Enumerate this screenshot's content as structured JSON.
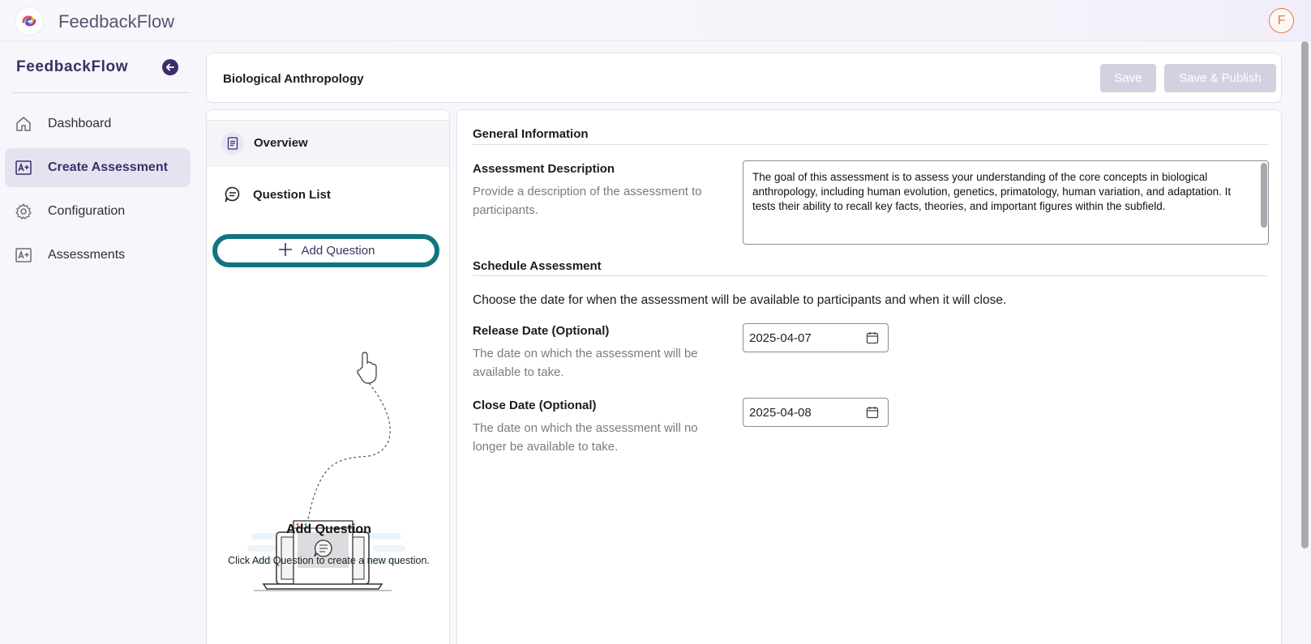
{
  "app": {
    "title": "FeedbackFlow",
    "avatar_letter": "F",
    "logo": "feedbackflow-logo-icon"
  },
  "sidebar": {
    "brand": "FeedbackFlow",
    "collapse_icon": "arrow-left-icon",
    "items": [
      {
        "label": "Dashboard",
        "icon": "home-icon",
        "active": false
      },
      {
        "label": "Create Assessment",
        "icon": "a-plus-icon",
        "active": true
      },
      {
        "label": "Configuration",
        "icon": "gear-icon",
        "active": false
      },
      {
        "label": "Assessments",
        "icon": "a-plus-icon",
        "active": false
      }
    ]
  },
  "header": {
    "title": "Biological Anthropology",
    "save_label": "Save",
    "publish_label": "Save & Publish"
  },
  "left_panel": {
    "overview_label": "Overview",
    "question_list_label": "Question List",
    "add_question_label": "Add Question",
    "empty_title": "Add Question",
    "empty_subtitle": "Click Add Question to create a new question."
  },
  "main": {
    "general_title": "General Information",
    "desc_label": "Assessment Description",
    "desc_help": "Provide a description of the assessment to participants.",
    "desc_value": "The goal of this assessment is to assess your understanding of the core concepts in biological anthropology, including human evolution, genetics, primatology, human variation, and adaptation. It tests their ability to recall key facts, theories, and important figures within the subfield.",
    "schedule_title": "Schedule Assessment",
    "schedule_text": "Choose the date for when the assessment will be available to participants and when it will close.",
    "release_label": "Release Date (Optional)",
    "release_help": "The date on which the assessment will be available to take.",
    "release_value": "2025-04-07",
    "close_label": "Close Date (Optional)",
    "close_help": "The date on which the assessment will no longer be available to take.",
    "close_value": "2025-04-08"
  },
  "colors": {
    "brand": "#3d2f63",
    "highlight_ring": "#127381",
    "disabled_button": "#d3d1df",
    "avatar": "#e07b4f"
  }
}
